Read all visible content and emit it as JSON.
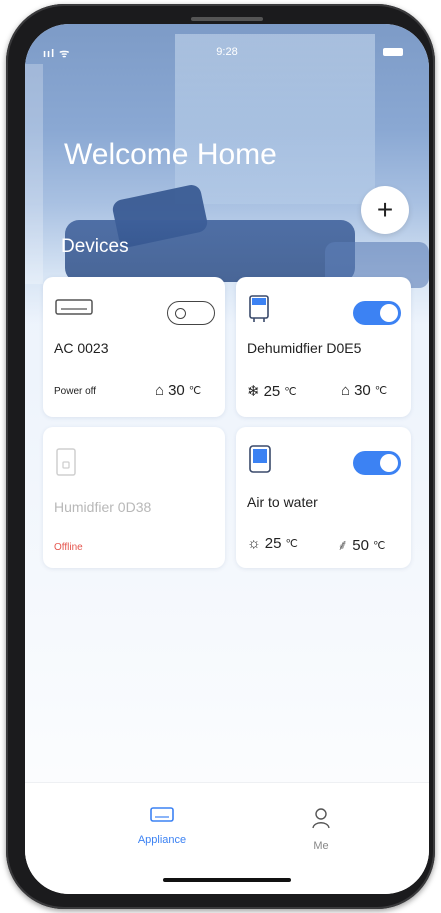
{
  "status_bar": {
    "signal": "ııl ᯤ",
    "time": "9:28"
  },
  "header": {
    "title": "Welcome Home",
    "add_label": "+"
  },
  "section": {
    "devices_label": "Devices"
  },
  "devices": [
    {
      "name": "AC 0023",
      "status": "Power off",
      "toggle": "off",
      "icon": "ac-unit-icon",
      "metric_right": {
        "icon": "home-temp-icon",
        "glyph": "⌂",
        "value": "30",
        "unit": "℃"
      }
    },
    {
      "name": "Dehumidfier D0E5",
      "toggle": "on",
      "icon": "dehumidifier-icon",
      "metric_left": {
        "icon": "snowflake-icon",
        "glyph": "❄",
        "value": "25",
        "unit": "℃"
      },
      "metric_right": {
        "icon": "home-temp-icon",
        "glyph": "⌂",
        "value": "30",
        "unit": "℃"
      }
    },
    {
      "name": "Humidfier 0D38",
      "status": "Offline",
      "icon": "humidifier-icon"
    },
    {
      "name": "Air to water",
      "toggle": "on",
      "icon": "air-to-water-icon",
      "metric_left": {
        "icon": "sun-icon",
        "glyph": "☼",
        "value": "25",
        "unit": "℃"
      },
      "metric_right": {
        "icon": "shower-icon",
        "glyph": "⸙",
        "value": "50",
        "unit": "℃"
      }
    }
  ],
  "tabs": [
    {
      "label": "Appliance",
      "icon": "appliance-icon",
      "active": true
    },
    {
      "label": "Me",
      "icon": "person-icon",
      "active": false
    }
  ],
  "colors": {
    "accent": "#3c82f3",
    "offline": "#e5564e"
  }
}
